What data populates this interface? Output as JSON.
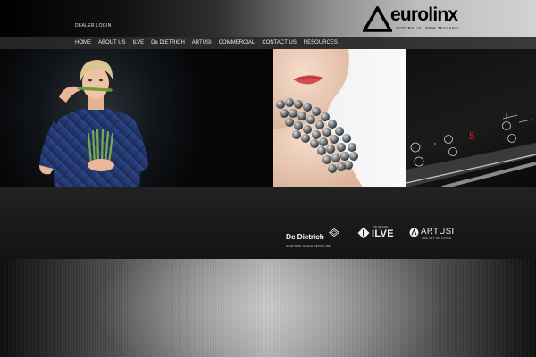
{
  "header": {
    "dealer_login": "DEALER LOGIN",
    "logo": {
      "word": "eurolinx",
      "tagline": "AUSTRALIA | NEW ZEALAND"
    }
  },
  "nav": {
    "items": [
      {
        "label": "HOME"
      },
      {
        "label": "ABOUT US"
      },
      {
        "label": "ILVE"
      },
      {
        "label": "De DIETRICH"
      },
      {
        "label": "ARTUSI"
      },
      {
        "label": "COMMERCIAL"
      },
      {
        "label": "CONTACT US"
      },
      {
        "label": "RESOURCES"
      }
    ]
  },
  "hero": {
    "panels": [
      {
        "subject": "woman-with-asparagus-photo"
      },
      {
        "subject": "pearl-necklace-photo"
      },
      {
        "subject": "induction-cooktop-photo",
        "display_digit": "5"
      }
    ]
  },
  "brands": {
    "de_dietrich": {
      "name": "De Dietrich",
      "tagline": "OBJETS DE VALEUR DEPUIS 1684"
    },
    "ilve": {
      "name": "ILVE",
      "tagline": "THE ORIGINAL"
    },
    "artusi": {
      "name": "ARTUSI",
      "tagline": "THE ART OF LIVING"
    }
  },
  "colors": {
    "accent_red": "#e8242b",
    "nav_bg": "#2a2a2a",
    "text_light": "#ececec"
  }
}
